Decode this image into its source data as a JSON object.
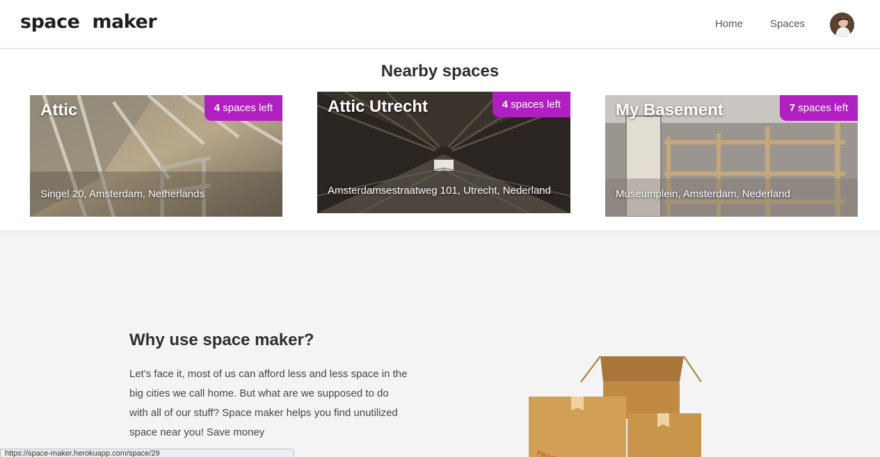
{
  "header": {
    "logo_word1": "space",
    "logo_word2": "maker",
    "nav": {
      "home": "Home",
      "spaces": "Spaces"
    }
  },
  "nearby": {
    "title": "Nearby spaces",
    "cards": [
      {
        "title": "Attic",
        "badge_count": "4",
        "badge_suffix": " spaces left",
        "address": "Singel 20, Amsterdam, Netherlands"
      },
      {
        "title": "Attic Utrecht",
        "badge_count": "4",
        "badge_suffix": " spaces left",
        "address": "Amsterdamsestraatweg 101, Utrecht, Nederland"
      },
      {
        "title": "My Basement",
        "badge_count": "7",
        "badge_suffix": " spaces left",
        "address": "Museumplein, Amsterdam, Nederland"
      }
    ]
  },
  "why": {
    "title": "Why use space maker?",
    "body": "Let's face it, most of us can afford less and less space in the big cities we call home. But what are we supposed to do with all of our stuff? Space maker helps you find unutilized space near you! Save money"
  },
  "status_bar": {
    "url": "https://space-maker.herokuapp.com/space/29"
  },
  "colors": {
    "badge": "#b01fc0",
    "page_bg": "#f4f4f4",
    "box": "#c8954a"
  },
  "icons": {
    "avatar": "user-avatar-photo",
    "illustration": "cardboard-boxes-illustration"
  }
}
